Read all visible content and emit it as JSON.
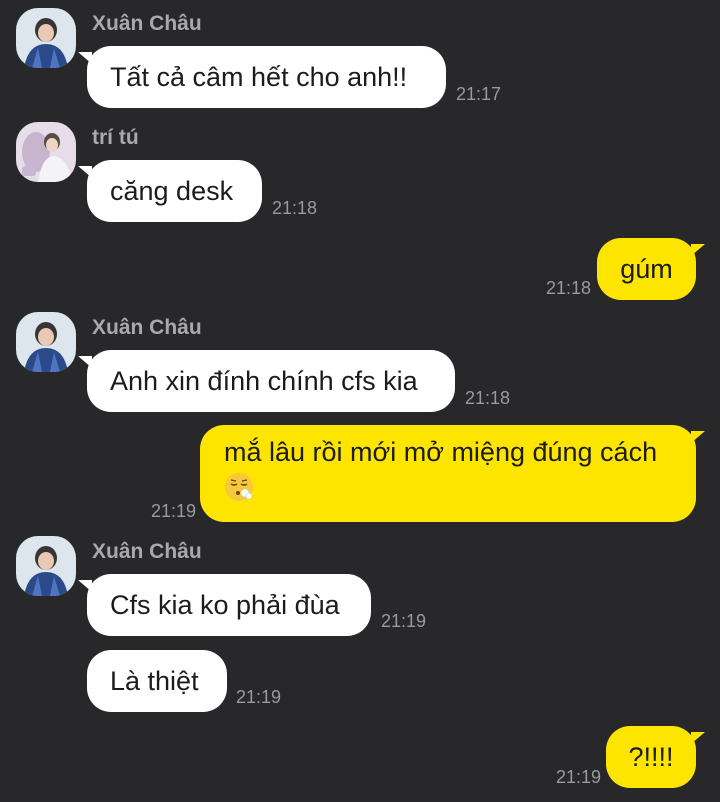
{
  "colors": {
    "background": "#28282b",
    "incoming_bubble": "#ffffff",
    "outgoing_bubble": "#fee500",
    "sender_name": "#a9a9ad",
    "timestamp": "#9a9a9e"
  },
  "messages": [
    {
      "sender": "Xuân Châu",
      "text": "Tất cả câm hết cho anh!!",
      "time": "21:17",
      "direction": "incoming"
    },
    {
      "sender": "trí tú",
      "text": "căng desk",
      "time": "21:18",
      "direction": "incoming"
    },
    {
      "text": "gúm",
      "time": "21:18",
      "direction": "outgoing"
    },
    {
      "sender": "Xuân Châu",
      "text": "Anh xin đính chính cfs kia",
      "time": "21:18",
      "direction": "incoming"
    },
    {
      "text": "mắ lâu rồi mới mở miệng đúng cách",
      "emoji": "face-exhaling-emoji",
      "time": "21:19",
      "direction": "outgoing"
    },
    {
      "sender": "Xuân Châu",
      "text": "Cfs kia ko phải đùa",
      "time": "21:19",
      "direction": "incoming"
    },
    {
      "text": "Là thiệt",
      "time": "21:19",
      "direction": "incoming"
    },
    {
      "text": "?!!!!",
      "time": "21:19",
      "direction": "outgoing"
    }
  ]
}
